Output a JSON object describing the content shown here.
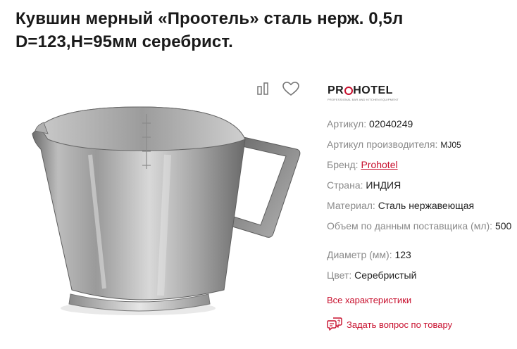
{
  "product": {
    "title": "Кувшин мерный «Проотель» сталь нерж. 0,5л D=123,H=95мм серебрист."
  },
  "actions": {
    "compare_icon": "compare-icon",
    "favorite_icon": "heart-icon"
  },
  "brand_logo": {
    "text_before": "PR",
    "text_after": "HOTEL",
    "tagline": "PROFESSIONAL BAR AND KITCHEN EQUIPMENT"
  },
  "specs": {
    "article": {
      "label": "Артикул:",
      "value": "02040249"
    },
    "maker_article": {
      "label": "Артикул производителя:",
      "value": "MJ05"
    },
    "brand": {
      "label": "Бренд:",
      "value": "Prohotel"
    },
    "country": {
      "label": "Страна:",
      "value": "ИНДИЯ"
    },
    "material": {
      "label": "Материал:",
      "value": "Сталь нержавеющая"
    },
    "volume": {
      "label": "Объем по данным поставщика (мл):",
      "value": "500"
    },
    "diameter": {
      "label": "Диаметр (мм):",
      "value": "123"
    },
    "color": {
      "label": "Цвет:",
      "value": "Серебристый"
    }
  },
  "links": {
    "all_characteristics": "Все характеристики",
    "ask_question": "Задать вопрос по товару"
  },
  "colors": {
    "accent": "#c8102e",
    "label_gray": "#8a8a8a",
    "text": "#222222"
  }
}
